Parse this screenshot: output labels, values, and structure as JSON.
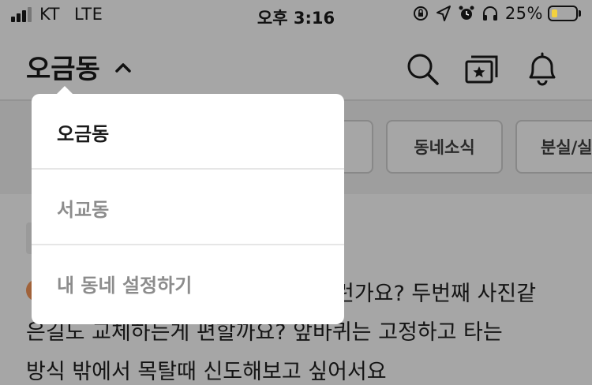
{
  "status_bar": {
    "carrier": "KT",
    "network": "LTE",
    "time": "오후 3:16",
    "battery_percent": "25%",
    "battery_level": 0.25,
    "icons": [
      "orientation-lock-icon",
      "location-arrow-icon",
      "alarm-icon",
      "headphones-icon"
    ]
  },
  "header": {
    "location": "오금동",
    "icons": [
      "search-icon",
      "catalog-icon",
      "bell-icon"
    ]
  },
  "chips": [
    "동네소식",
    "분실/실종"
  ],
  "feed": {
    "lines": [
      "런가요? 두번째 사진같",
      "은길도 교체하는게 편할까요? 앞바퀴는 고정하고 타는",
      "방식 밖에서 목탈때 신도해보고 싶어서요"
    ]
  },
  "dropdown": {
    "items": [
      {
        "label": "오금동",
        "state": "selected"
      },
      {
        "label": "서교동",
        "state": "normal"
      },
      {
        "label": "내 동네 설정하기",
        "state": "action"
      }
    ]
  },
  "colors": {
    "overlay_background": "#a6a6a6",
    "dropdown_background": "#ffffff",
    "battery_fill": "#f3d13e",
    "avatar": "#a0623a"
  }
}
